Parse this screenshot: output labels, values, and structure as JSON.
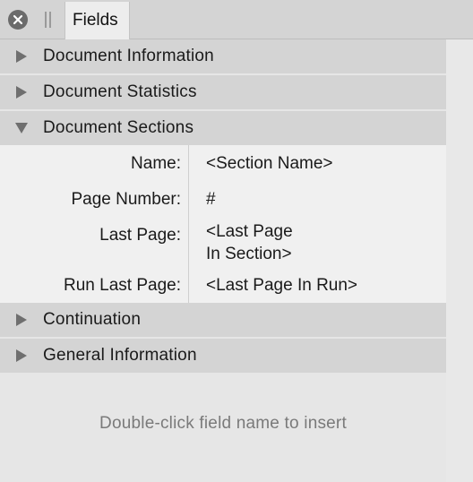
{
  "panel": {
    "tab_label": "Fields",
    "hint": "Double-click field name to insert"
  },
  "sections": {
    "document_information": {
      "label": "Document Information",
      "expanded": false
    },
    "document_statistics": {
      "label": "Document Statistics",
      "expanded": false
    },
    "document_sections": {
      "label": "Document Sections",
      "expanded": true,
      "fields": [
        {
          "name": "Name:",
          "value": "<Section Name>"
        },
        {
          "name": "Page Number:",
          "value": "#"
        },
        {
          "name": "Last Page:",
          "value": "<Last Page\nIn Section>"
        },
        {
          "name": "Run Last Page:",
          "value": "<Last Page In Run>"
        }
      ]
    },
    "continuation": {
      "label": "Continuation",
      "expanded": false
    },
    "general_information": {
      "label": "General Information",
      "expanded": false
    }
  },
  "icons": {
    "close": "close-icon",
    "grip": "grip-icon",
    "collapsed": "triangle-right-icon",
    "expanded": "triangle-down-icon"
  },
  "colors": {
    "header_bg": "#d4d4d4",
    "row_bg": "#f0f0f0",
    "panel_bg": "#e6e6e6",
    "hint_text": "#7a7a7a"
  }
}
